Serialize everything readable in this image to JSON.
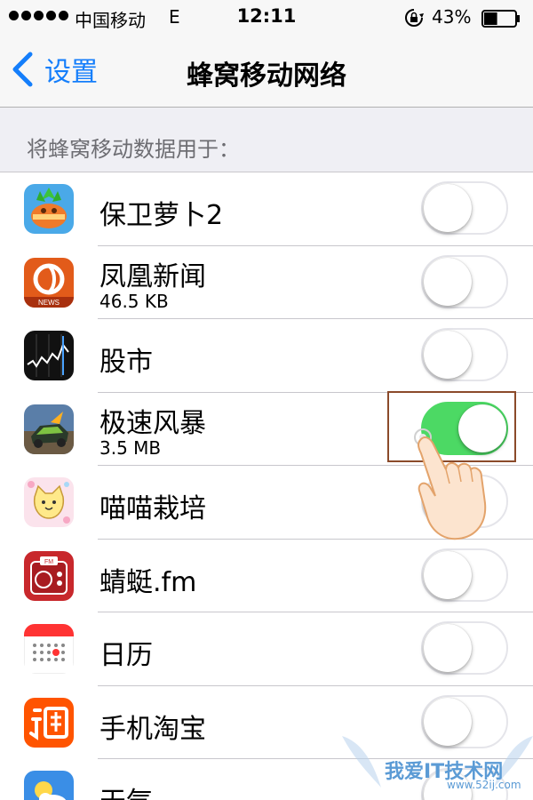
{
  "status_bar": {
    "carrier": "中国移动",
    "network": "E",
    "time": "12:11",
    "battery_percent": "43%",
    "battery_level": 0.43,
    "signal_bars_filled": 5,
    "icons": [
      "signal-dots-icon",
      "rotation-lock-icon",
      "battery-icon"
    ]
  },
  "nav": {
    "back_label": "设置",
    "title": "蜂窝移动网络"
  },
  "section_header": "将蜂窝移动数据用于：",
  "apps": [
    {
      "name": "保卫萝卜2",
      "usage": null,
      "enabled": false,
      "icon": "carrot-app-icon"
    },
    {
      "name": "凤凰新闻",
      "usage": "46.5 KB",
      "enabled": false,
      "icon": "phoenix-news-icon"
    },
    {
      "name": "股市",
      "usage": null,
      "enabled": false,
      "icon": "stocks-icon"
    },
    {
      "name": "极速风暴",
      "usage": "3.5 MB",
      "enabled": true,
      "icon": "racing-game-icon"
    },
    {
      "name": "喵喵栽培",
      "usage": null,
      "enabled": false,
      "icon": "cat-app-icon"
    },
    {
      "name": "蜻蜓.fm",
      "usage": null,
      "enabled": false,
      "icon": "radio-icon"
    },
    {
      "name": "日历",
      "usage": null,
      "enabled": false,
      "icon": "calendar-icon"
    },
    {
      "name": "手机淘宝",
      "usage": null,
      "enabled": false,
      "icon": "taobao-icon"
    },
    {
      "name": "天气",
      "usage": null,
      "enabled": false,
      "icon": "weather-icon"
    }
  ],
  "watermark": {
    "title": "我爱IT技术网",
    "url": "www.52ij.com"
  },
  "colors": {
    "accent": "#147efb",
    "toggle_on": "#4cd964",
    "highlight_box": "#8b4a2a"
  }
}
